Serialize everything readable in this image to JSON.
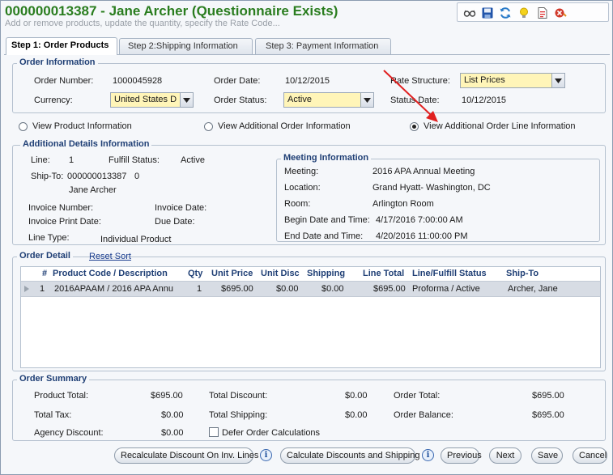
{
  "header": {
    "title": "000000013387 - Jane Archer (Questionnaire Exists)",
    "subtitle": "Add or remove products, update the quantity, specify the Rate Code..."
  },
  "toolbar": {
    "icons": [
      "glasses-icon",
      "save-icon",
      "refresh-icon",
      "lightbulb-icon",
      "report-icon",
      "close-record-icon"
    ]
  },
  "tabs": [
    {
      "label": "Step 1: Order Products",
      "active": true
    },
    {
      "label": "Step 2:Shipping Information",
      "active": false
    },
    {
      "label": "Step 3: Payment Information",
      "active": false
    }
  ],
  "order_info": {
    "legend": "Order Information",
    "order_number_label": "Order Number:",
    "order_number": "1000045928",
    "order_date_label": "Order Date:",
    "order_date": "10/12/2015",
    "rate_structure_label": "Rate Structure:",
    "rate_structure": "List Prices",
    "currency_label": "Currency:",
    "currency": "United States D",
    "order_status_label": "Order Status:",
    "order_status": "Active",
    "status_date_label": "Status Date:",
    "status_date": "10/12/2015"
  },
  "view_options": {
    "product_info": "View Product Information",
    "additional_order_info": "View Additional Order Information",
    "additional_line_info": "View Additional Order Line Information",
    "selected": "additional_line_info"
  },
  "additional_details": {
    "legend": "Additional Details Information",
    "line_label": "Line:",
    "line": "1",
    "fulfill_status_label": "Fulfill Status:",
    "fulfill_status": "Active",
    "ship_to_label": "Ship-To:",
    "ship_to_id": "000000013387",
    "ship_to_num": "0",
    "ship_to_name": "Jane Archer",
    "invoice_number_label": "Invoice Number:",
    "invoice_date_label": "Invoice Date:",
    "invoice_print_date_label": "Invoice Print Date:",
    "due_date_label": "Due Date:",
    "line_type_label": "Line Type:",
    "line_type": "Individual Product"
  },
  "meeting_info": {
    "legend": "Meeting Information",
    "meeting_label": "Meeting:",
    "meeting": "2016 APA Annual Meeting",
    "location_label": "Location:",
    "location": "Grand Hyatt- Washington, DC",
    "room_label": "Room:",
    "room": "Arlington Room",
    "begin_label": "Begin Date and Time:",
    "begin": "4/17/2016 7:00:00 AM",
    "end_label": "End Date and Time:",
    "end": "4/20/2016 11:00:00 PM"
  },
  "order_detail": {
    "legend": "Order Detail",
    "reset_sort": "Reset Sort",
    "columns": {
      "num": "#",
      "product": "Product Code / Description",
      "qty": "Qty",
      "unit_price": "Unit Price",
      "unit_disc": "Unit Disc",
      "shipping": "Shipping",
      "line_total": "Line Total",
      "line_status": "Line/Fulfill Status",
      "ship_to": "Ship-To"
    },
    "rows": [
      {
        "num": "1",
        "product": "2016APAAM / 2016 APA Annu",
        "qty": "1",
        "unit_price": "$695.00",
        "unit_disc": "$0.00",
        "shipping": "$0.00",
        "line_total": "$695.00",
        "line_status": "Proforma / Active",
        "ship_to": "Archer, Jane"
      }
    ]
  },
  "summary": {
    "legend": "Order Summary",
    "product_total_label": "Product Total:",
    "product_total": "$695.00",
    "total_discount_label": "Total Discount:",
    "total_discount": "$0.00",
    "order_total_label": "Order Total:",
    "order_total": "$695.00",
    "total_tax_label": "Total Tax:",
    "total_tax": "$0.00",
    "total_shipping_label": "Total Shipping:",
    "total_shipping": "$0.00",
    "order_balance_label": "Order Balance:",
    "order_balance": "$695.00",
    "agency_discount_label": "Agency Discount:",
    "agency_discount": "$0.00",
    "defer_label": "Defer Order Calculations"
  },
  "buttons": {
    "recalc": "Recalculate Discount On Inv. Lines",
    "calc": "Calculate Discounts and Shipping",
    "previous": "Previous",
    "next": "Next",
    "save": "Save",
    "cancel": "Cancel",
    "info_glyph": "i"
  },
  "colors": {
    "title": "#2a7d1f",
    "legend": "#1f3f75",
    "required_field": "#fff5b8",
    "annotation_arrow": "#e02020"
  }
}
